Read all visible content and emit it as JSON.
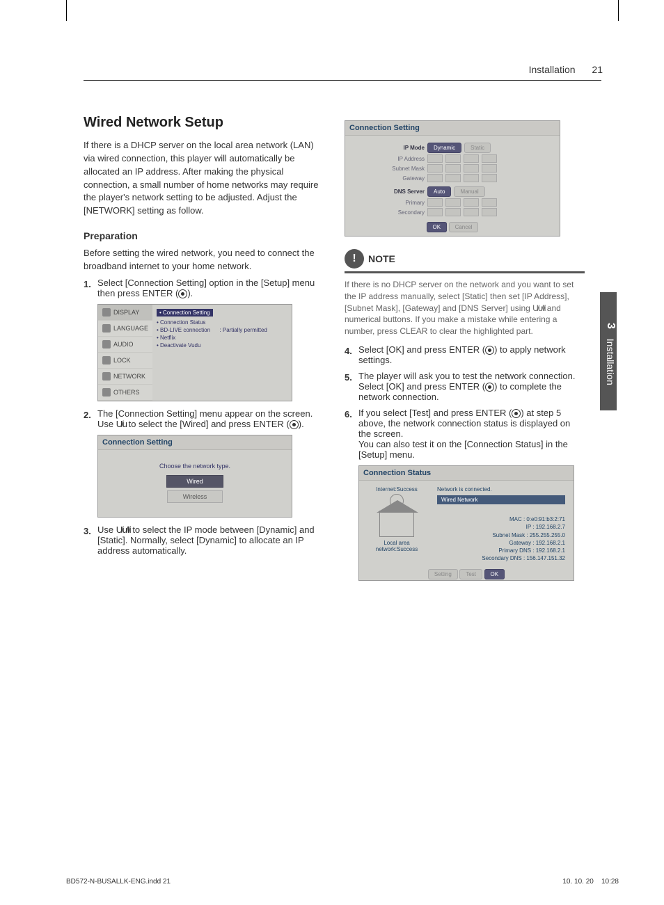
{
  "header": {
    "section": "Installation",
    "page": "21"
  },
  "sidetab": {
    "chapter": "3",
    "label": "Installation"
  },
  "left": {
    "h1": "Wired Network Setup",
    "intro": "If there is a DHCP server on the local area network (LAN) via wired connection, this player will automatically be allocated an IP address. After making the physical connection, a small number of home networks may require the player's network setting to be adjusted. Adjust the [NETWORK] setting as follow.",
    "h2": "Preparation",
    "prepText": "Before setting the wired network, you need to connect the broadband internet to your home network.",
    "step1": "Select [Connection Setting] option in the [Setup] menu then press ENTER (",
    "step1b": ").",
    "setupMenu": {
      "items": [
        "DISPLAY",
        "LANGUAGE",
        "AUDIO",
        "LOCK",
        "NETWORK",
        "OTHERS"
      ],
      "right": {
        "hl": "• Connection Setting",
        "r1": "• Connection Status",
        "r2a": "• BD-LIVE connection",
        "r2b": ": Partially permitted",
        "r3": "• Netflix",
        "r4": "• Deactivate Vudu"
      }
    },
    "step2a": "The [Connection Setting] menu appear on the screen. Use ",
    "step2b": " to select the [Wired] and press ENTER (",
    "step2c": ").",
    "connSetting": {
      "title": "Connection Setting",
      "subtitle": "Choose the network type.",
      "btn1": "Wired",
      "btn2": "Wireless"
    },
    "step3a": "Use ",
    "step3b": " to select the IP mode between [Dynamic] and [Static]. Normally, select [Dynamic] to allocate an IP address automatically."
  },
  "right": {
    "ipScreen": {
      "title": "Connection Setting",
      "rows": {
        "ipmode": "IP Mode",
        "dynamic": "Dynamic",
        "static": "Static",
        "ipaddr": "IP Address",
        "subnet": "Subnet Mask",
        "gateway": "Gateway",
        "dns": "DNS Server",
        "auto": "Auto",
        "manual": "Manual",
        "primary": "Primary",
        "secondary": "Secondary"
      },
      "ok": "OK",
      "cancel": "Cancel"
    },
    "note": {
      "title": "NOTE",
      "text1": "If there is no DHCP server on the network and you want to set the IP address manually, select [Static] then set [IP Address], [Subnet Mask], [Gateway] and [DNS Server] using ",
      "text2": " and numerical buttons. If you make a mistake while entering a number, press CLEAR to clear the highlighted part."
    },
    "step4a": "Select [OK] and press ENTER (",
    "step4b": ") to apply network settings.",
    "step5a": "The player will ask you to test the network connection. Select [OK] and press ENTER (",
    "step5b": ") to complete the network connection.",
    "step6a": "If you select [Test] and press ENTER (",
    "step6b": ") at step 5 above, the network connection status is displayed on the screen.",
    "step6c": "You can also test it on the [Connection Status] in the [Setup] menu.",
    "status": {
      "title": "Connection Status",
      "internet": "Internet:Success",
      "lan": "Local area network:Success",
      "connected": "Network is connected.",
      "bar": "Wired Network",
      "mac": "MAC : 0:e0:91:b3:2:71",
      "ip": "IP : 192.168.2.7",
      "subnet": "Subnet Mask : 255.255.255.0",
      "gateway": "Gateway : 192.168.2.1",
      "pdns": "Primary DNS : 192.168.2.1",
      "sdns": "Secondary DNS : 156.147.151.32",
      "setting": "Setting",
      "test": "Test",
      "ok": "OK"
    }
  },
  "arrows": {
    "ud": "U/u",
    "udlr": "U/u/I/i"
  },
  "footer": {
    "file": "BD572-N-BUSALLK-ENG.indd   21",
    "date": "10. 10. 20",
    "time": "10:28"
  }
}
